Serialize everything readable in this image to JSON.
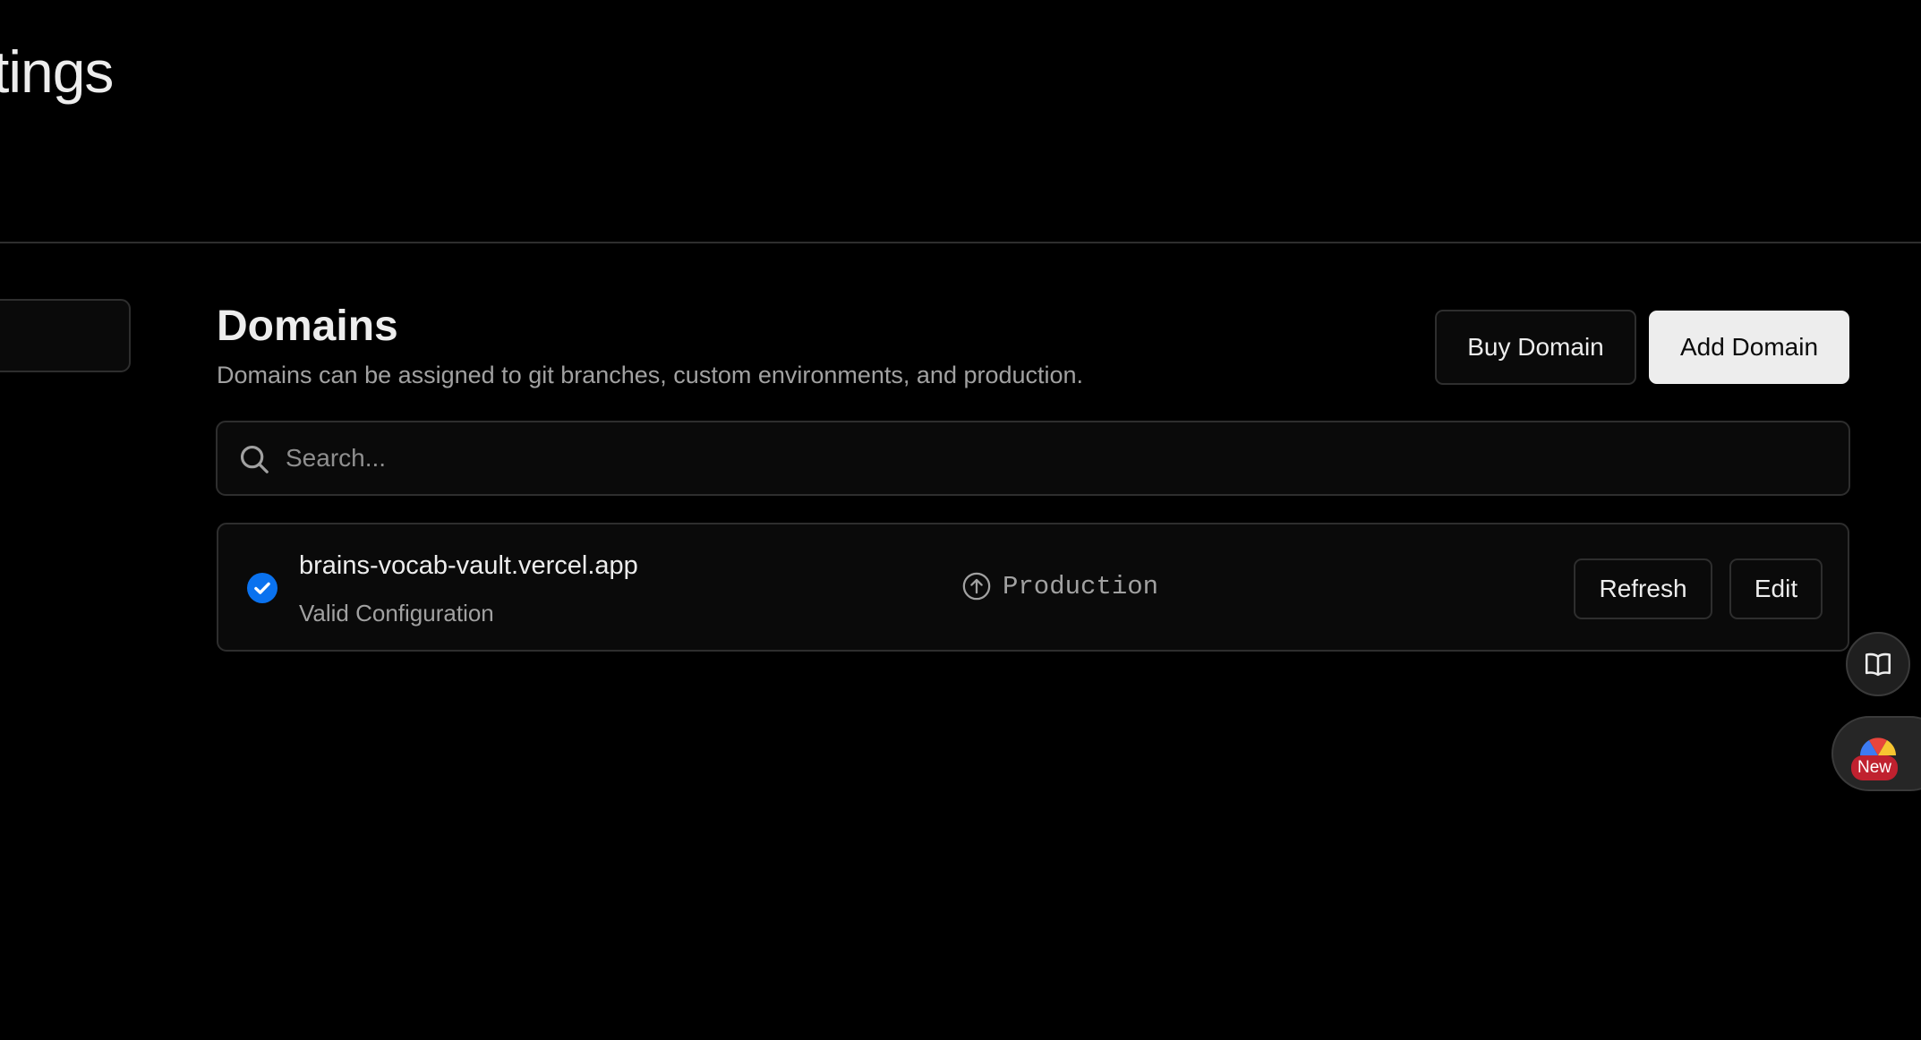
{
  "header": {
    "title": "tings"
  },
  "domains": {
    "title": "Domains",
    "subtitle": "Domains can be assigned to git branches, custom environments, and production.",
    "buy_label": "Buy Domain",
    "add_label": "Add Domain",
    "search": {
      "placeholder": "Search...",
      "value": ""
    },
    "items": [
      {
        "name": "brains-vocab-vault.vercel.app",
        "status": "Valid Configuration",
        "environment": "Production",
        "refresh_label": "Refresh",
        "edit_label": "Edit"
      }
    ]
  },
  "floating": {
    "docs_icon": "book-open-icon",
    "new_badge": "New"
  },
  "colors": {
    "background": "#000000",
    "surface": "#0a0a0a",
    "border": "#2e2e2e",
    "text": "#ededed",
    "muted": "#a1a1a1",
    "check": "#0a72ef",
    "badge": "#c0212f"
  }
}
